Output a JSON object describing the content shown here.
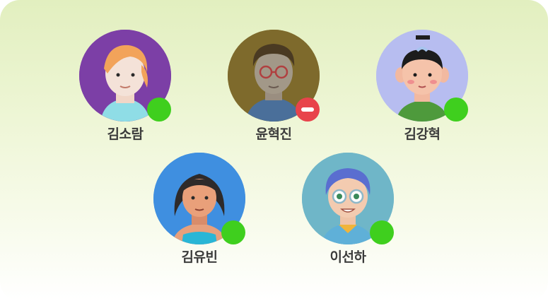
{
  "members": [
    {
      "name": "김소람",
      "status": "online",
      "avatar_bg": "#7c3fa6"
    },
    {
      "name": "윤혁진",
      "status": "busy",
      "avatar_bg": "#7e6a2c"
    },
    {
      "name": "김강혁",
      "status": "online",
      "avatar_bg": "#b7bdf0"
    },
    {
      "name": "김유빈",
      "status": "online",
      "avatar_bg": "#3f8fe0"
    },
    {
      "name": "이선하",
      "status": "online",
      "avatar_bg": "#6fb6c8"
    }
  ],
  "colors": {
    "online": "#3fcf1e",
    "busy": "#e8434b",
    "name_text": "#3b3b3b"
  }
}
